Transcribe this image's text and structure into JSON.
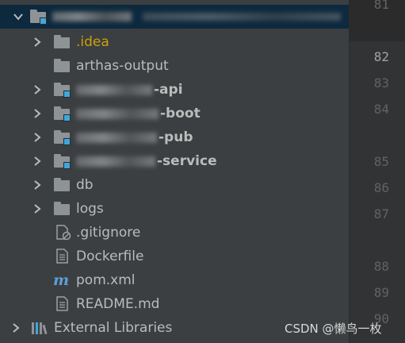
{
  "project_tree": {
    "root": {
      "label": ""
    },
    "items": [
      {
        "label": ".idea"
      },
      {
        "label": "arthas-output"
      },
      {
        "label": "-api"
      },
      {
        "label": "-boot"
      },
      {
        "label": "-pub"
      },
      {
        "label": "-service"
      },
      {
        "label": "db"
      },
      {
        "label": "logs"
      },
      {
        "label": ".gitignore"
      },
      {
        "label": "Dockerfile"
      },
      {
        "label": "pom.xml"
      },
      {
        "label": "README.md"
      }
    ],
    "external_libraries": "External Libraries"
  },
  "gutter": {
    "line_numbers": [
      "81",
      "82",
      "83",
      "84",
      "85",
      "86",
      "87",
      "88",
      "89",
      "90"
    ],
    "current_line": "82"
  },
  "watermark": "CSDN @懒鸟一枚",
  "colors": {
    "background": "#3c3f41",
    "selection": "#0d293e",
    "folder": "#8e9396",
    "module_badge": "#3ea8de",
    "idea_folder_text": "#c9a10d",
    "gutter_background": "#313335"
  }
}
